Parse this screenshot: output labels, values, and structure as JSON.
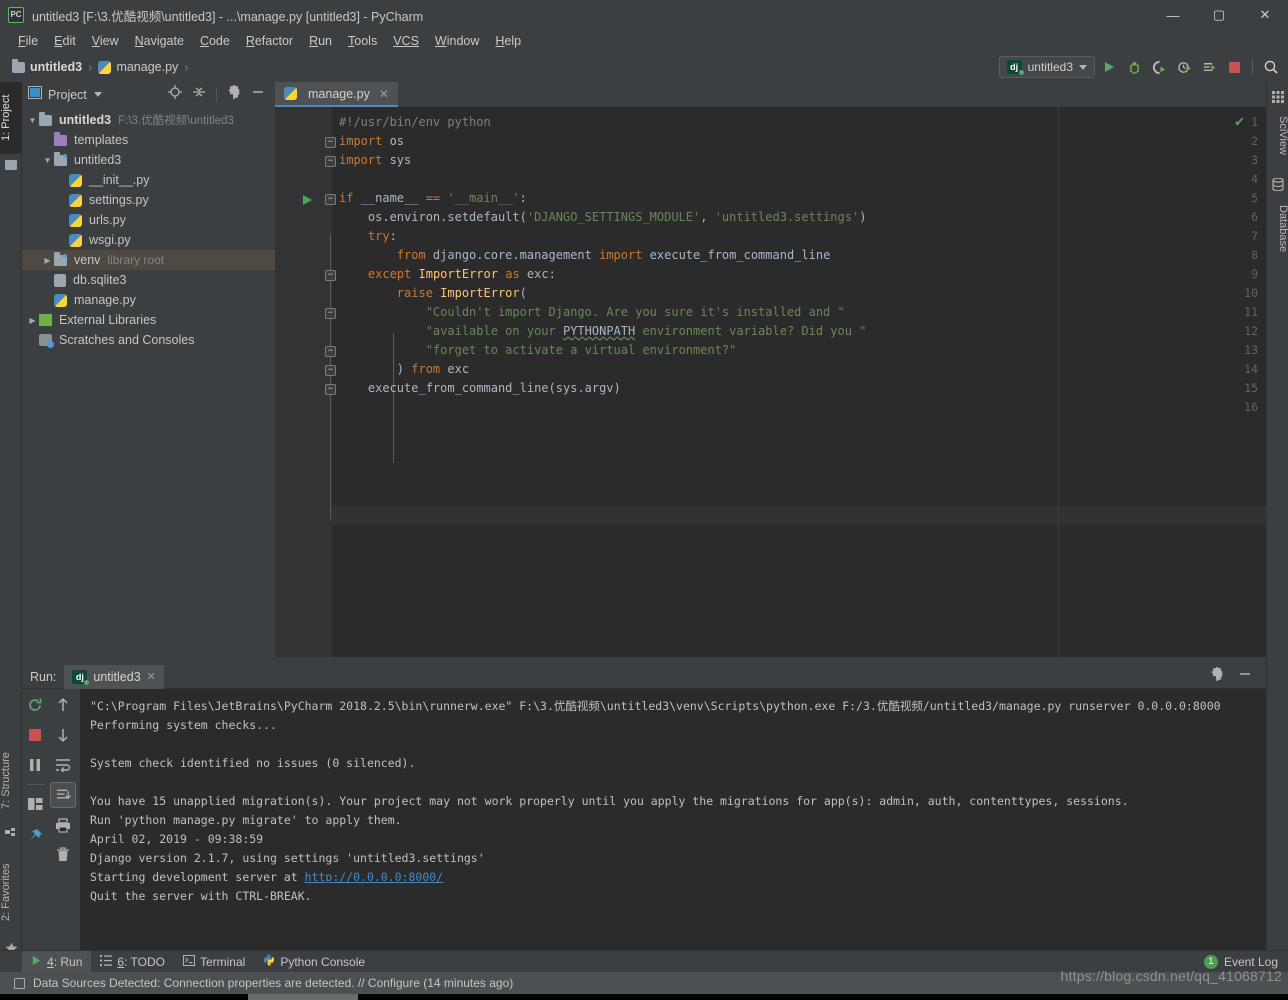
{
  "window": {
    "title": "untitled3 [F:\\3.优酷视频\\untitled3] - ...\\manage.py [untitled3] - PyCharm",
    "logo_text": "PC",
    "minimize": "—",
    "maximize": "▢",
    "close": "✕"
  },
  "menu": {
    "items": [
      {
        "pre": "F",
        "rest": "ile"
      },
      {
        "pre": "E",
        "rest": "dit"
      },
      {
        "pre": "V",
        "rest": "iew"
      },
      {
        "pre": "N",
        "rest": "avigate"
      },
      {
        "pre": "C",
        "rest": "ode"
      },
      {
        "pre": "R",
        "rest": "efactor"
      },
      {
        "pre": "R",
        "rest": "un"
      },
      {
        "pre": "T",
        "rest": "ools"
      },
      {
        "pre": "VCS",
        "rest": ""
      },
      {
        "pre": "W",
        "rest": "indow"
      },
      {
        "pre": "H",
        "rest": "elp"
      }
    ]
  },
  "navbar": {
    "crumb1": "untitled3",
    "crumb2": "manage.py",
    "separator": "›",
    "run_config": "untitled3",
    "dj_badge": "dj",
    "actions": [
      "run-icon",
      "debug-icon",
      "coverage-icon",
      "profile-icon",
      "run-with-console-icon",
      "stop-icon",
      "search-icon"
    ]
  },
  "left_strip": {
    "project_tab": "1: Project",
    "structure_tab": "7: Structure",
    "favorites_tab": "2: Favorites"
  },
  "right_strip": {
    "sciview_tab": "SciView",
    "database_tab": "Database"
  },
  "project_panel": {
    "title": "Project",
    "header_icons": [
      "locate-icon",
      "collapse-all-icon",
      "settings-icon",
      "hide-icon"
    ],
    "tree": [
      {
        "indent": 0,
        "arrow": "▼",
        "icon": "folder-icon",
        "label": "untitled3",
        "bold": true,
        "path": "F:\\3.优酷视频\\untitled3",
        "selected": false
      },
      {
        "indent": 1,
        "arrow": "",
        "icon": "folder-purple-icon",
        "label": "templates",
        "bold": false,
        "path": "",
        "selected": false
      },
      {
        "indent": 1,
        "arrow": "▼",
        "icon": "folder-source-icon",
        "label": "untitled3",
        "bold": false,
        "path": "",
        "selected": false
      },
      {
        "indent": 2,
        "arrow": "",
        "icon": "python-file-icon",
        "label": "__init__.py",
        "bold": false,
        "path": "",
        "selected": false
      },
      {
        "indent": 2,
        "arrow": "",
        "icon": "python-file-icon",
        "label": "settings.py",
        "bold": false,
        "path": "",
        "selected": false
      },
      {
        "indent": 2,
        "arrow": "",
        "icon": "python-file-icon",
        "label": "urls.py",
        "bold": false,
        "path": "",
        "selected": false
      },
      {
        "indent": 2,
        "arrow": "",
        "icon": "python-file-icon",
        "label": "wsgi.py",
        "bold": false,
        "path": "",
        "selected": false
      },
      {
        "indent": 1,
        "arrow": "▶",
        "icon": "folder-source-icon",
        "label": "venv",
        "bold": false,
        "path": "library root",
        "selected": true
      },
      {
        "indent": 1,
        "arrow": "",
        "icon": "db-file-icon",
        "label": "db.sqlite3",
        "bold": false,
        "path": "",
        "selected": false
      },
      {
        "indent": 1,
        "arrow": "",
        "icon": "python-file-icon",
        "label": "manage.py",
        "bold": false,
        "path": "",
        "selected": false
      },
      {
        "indent": 0,
        "arrow": "▶",
        "icon": "library-icon",
        "label": "External Libraries",
        "bold": false,
        "path": "",
        "selected": false
      },
      {
        "indent": 0,
        "arrow": "",
        "icon": "scratches-icon",
        "label": "Scratches and Consoles",
        "bold": false,
        "path": "",
        "selected": false
      }
    ]
  },
  "editor": {
    "tab_label": "manage.py",
    "tab_close": "✕",
    "inspection_status": "✔",
    "lines": [
      {
        "n": 1,
        "fold": "",
        "run": false,
        "html": "<span class='cmt'>#!/usr/bin/env python</span>"
      },
      {
        "n": 2,
        "fold": "−",
        "run": false,
        "html": "<span class='kw'>import</span> os"
      },
      {
        "n": 3,
        "fold": "−",
        "run": false,
        "html": "<span class='kw'>import</span> sys"
      },
      {
        "n": 4,
        "fold": "",
        "run": false,
        "html": ""
      },
      {
        "n": 5,
        "fold": "−",
        "run": true,
        "html": "<span class='kw'>if</span> __name__ <span class='kw'>==</span> <span class='str'>'__main__'</span>:"
      },
      {
        "n": 6,
        "fold": "",
        "run": false,
        "html": "    os.environ.setdefault(<span class='str'>'DJANGO_SETTINGS_MODULE'</span>, <span class='str'>'untitled3.settings'</span>)"
      },
      {
        "n": 7,
        "fold": "",
        "run": false,
        "html": "    <span class='kw'>try</span>:"
      },
      {
        "n": 8,
        "fold": "",
        "run": false,
        "html": "        <span class='kw'>from</span> django.core.management <span class='kw'>import</span> execute_from_command_line"
      },
      {
        "n": 9,
        "fold": "−",
        "run": false,
        "html": "    <span class='kw'>except</span> <span class='fn'>ImportError</span> <span class='kw'>as</span> exc:"
      },
      {
        "n": 10,
        "fold": "",
        "run": false,
        "html": "        <span class='kw'>raise</span> <span class='fn'>ImportError</span>("
      },
      {
        "n": 11,
        "fold": "−",
        "run": false,
        "html": "            <span class='str'>\"Couldn't import Django. Are you sure it's installed and \"</span>"
      },
      {
        "n": 12,
        "fold": "",
        "run": false,
        "html": "            <span class='str'>\"available on your </span><span class='err'>PYTHONPATH</span><span class='str'> environment variable? Did you \"</span>"
      },
      {
        "n": 13,
        "fold": "−",
        "run": false,
        "html": "            <span class='str'>\"forget to activate a virtual environment?\"</span>"
      },
      {
        "n": 14,
        "fold": "−",
        "run": false,
        "html": "        ) <span class='kw'>from</span> exc"
      },
      {
        "n": 15,
        "fold": "−",
        "run": false,
        "html": "    execute_from_command_line(sys.argv)"
      },
      {
        "n": 16,
        "fold": "",
        "run": false,
        "html": ""
      }
    ]
  },
  "run_window": {
    "label": "Run:",
    "tab_label": "untitled3",
    "tab_badge": "dj",
    "tab_close": "✕",
    "header_icons": [
      "settings-icon",
      "hide-icon"
    ],
    "toolbar_left": [
      "rerun-icon",
      "stop-icon",
      "pause-icon",
      "layout-icon",
      "pin-icon"
    ],
    "toolbar_right": [
      "up-icon",
      "down-icon",
      "soft-wrap-icon",
      "scroll-to-end-icon",
      "print-icon",
      "trash-icon"
    ],
    "console": [
      "\"C:\\Program Files\\JetBrains\\PyCharm 2018.2.5\\bin\\runnerw.exe\" F:\\3.优酷视频\\untitled3\\venv\\Scripts\\python.exe F:/3.优酷视频/untitled3/manage.py runserver 0.0.0.0:8000",
      "Performing system checks...",
      "",
      "System check identified no issues (0 silenced).",
      "",
      "You have 15 unapplied migration(s). Your project may not work properly until you apply the migrations for app(s): admin, auth, contenttypes, sessions.",
      "Run 'python manage.py migrate' to apply them.",
      "April 02, 2019 - 09:38:59",
      "Django version 2.1.7, using settings 'untitled3.settings'",
      "Starting development server at ",
      "Quit the server with CTRL-BREAK."
    ],
    "console_link": "http://0.0.0.0:8000/"
  },
  "bottom_bar": {
    "tabs": [
      {
        "icon": "run-icon",
        "pre": "4",
        "label": ": Run",
        "selected": true
      },
      {
        "icon": "todo-icon",
        "pre": "6",
        "label": ": TODO",
        "selected": false
      },
      {
        "icon": "terminal-icon",
        "pre": "",
        "label": "Terminal",
        "selected": false
      },
      {
        "icon": "python-console-icon",
        "pre": "",
        "label": "Python Console",
        "selected": false
      }
    ],
    "event_log": "Event Log",
    "event_count": "1"
  },
  "status_bar": {
    "icon": "notification-icon",
    "text": "Data Sources Detected: Connection properties are detected. // Configure (14 minutes ago)"
  },
  "watermark": {
    "text": "https://blog.csdn.net/qq_41068712"
  },
  "colors": {
    "accent_blue": "#4a88c7",
    "green": "#59a869",
    "red": "#c75450",
    "panel_bg": "#3c3f41",
    "editor_bg": "#2b2b2b",
    "selection": "#4e4a41"
  }
}
